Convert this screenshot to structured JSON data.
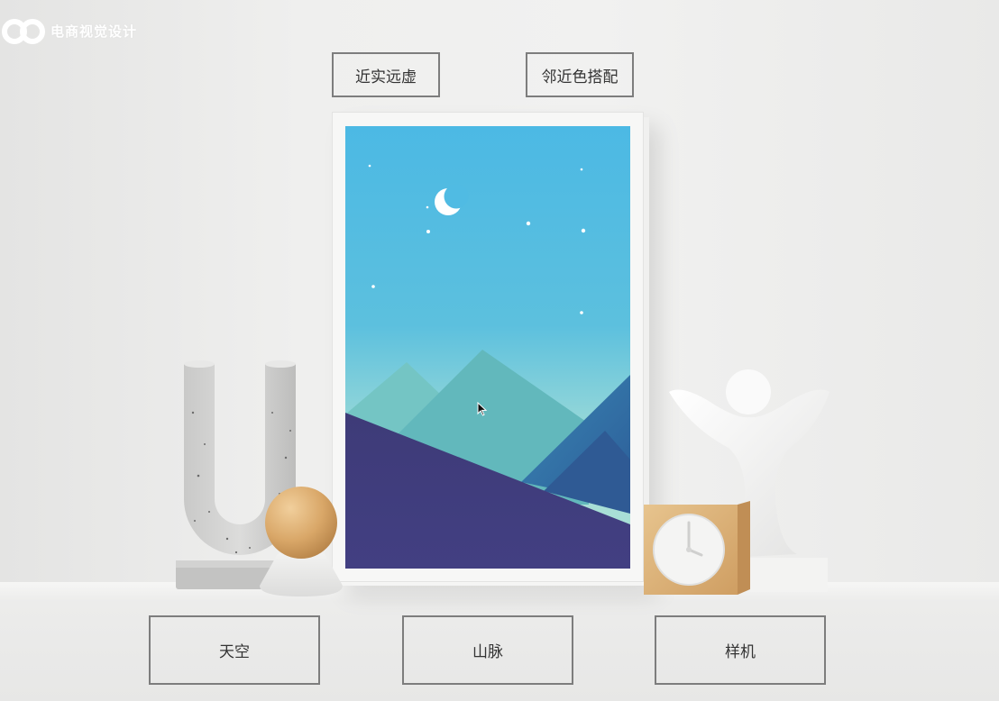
{
  "brand": {
    "name": "电商视觉设计",
    "logo_icon": "infinity-logo-icon",
    "color": "#ffffff"
  },
  "top_labels": [
    {
      "text": "近实远虚"
    },
    {
      "text": "邻近色搭配"
    }
  ],
  "bottom_labels": [
    {
      "text": "天空"
    },
    {
      "text": "山脉"
    },
    {
      "text": "样机"
    }
  ],
  "artwork": {
    "sky_top": "#4cb9e4",
    "sky_bottom": "#a8dfd6",
    "mountain_far": "#6ec1c2",
    "mountain_mid": "#5fb5bb",
    "mountain_right": "#3478a8",
    "ground": "#403f7c"
  },
  "icons": {
    "moon": "moon-icon",
    "cursor": "mouse-cursor-icon",
    "clock": "clock-icon"
  }
}
